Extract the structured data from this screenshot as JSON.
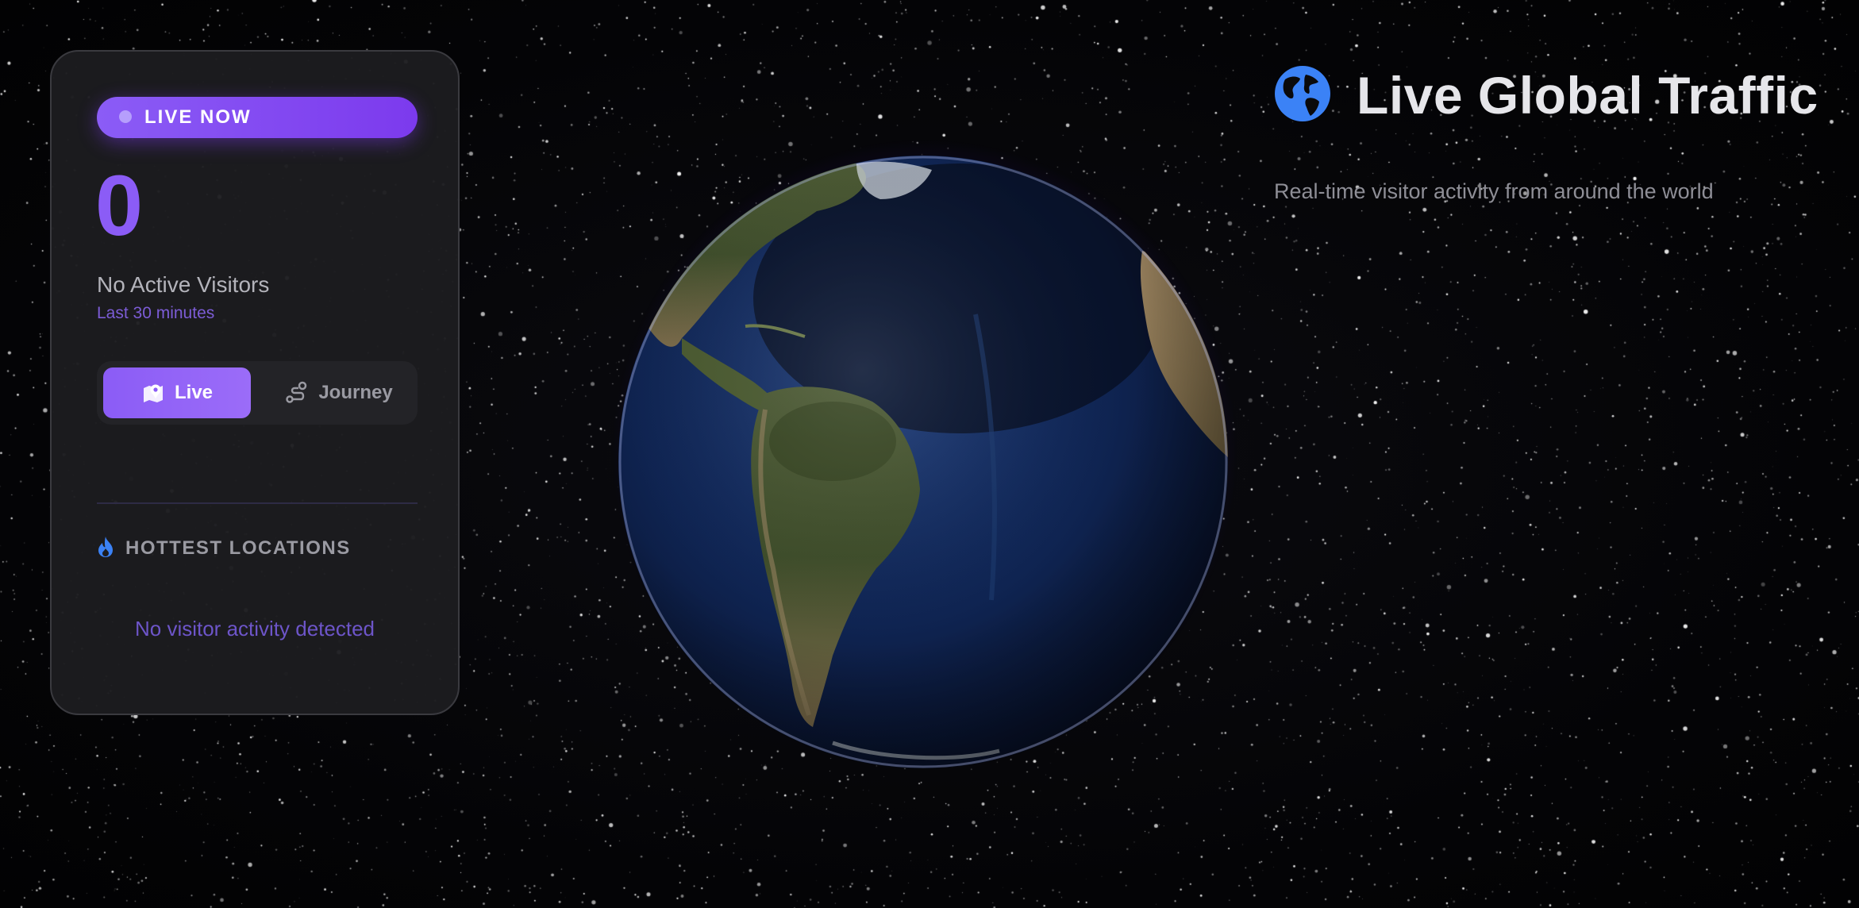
{
  "panel": {
    "badge_label": "LIVE NOW",
    "visitor_count": "0",
    "visitor_status": "No Active Visitors",
    "visitor_window": "Last 30 minutes",
    "modes": [
      {
        "label": "Live",
        "icon": "map-pin-icon",
        "selected": true
      },
      {
        "label": "Journey",
        "icon": "route-icon",
        "selected": false
      }
    ],
    "hottest": {
      "title": "HOTTEST LOCATIONS",
      "icon": "flame-icon",
      "empty_message": "No visitor activity detected"
    }
  },
  "header": {
    "title": "Live Global Traffic",
    "icon": "globe-icon",
    "subtitle": "Real-time visitor activity from around the world"
  },
  "colors": {
    "accent": "#8b5cf6",
    "accent_dark": "#7c3aed",
    "globe_icon": "#3b82f6",
    "flame_icon": "#3b82f6",
    "panel_bg": "#1c1c1f"
  }
}
